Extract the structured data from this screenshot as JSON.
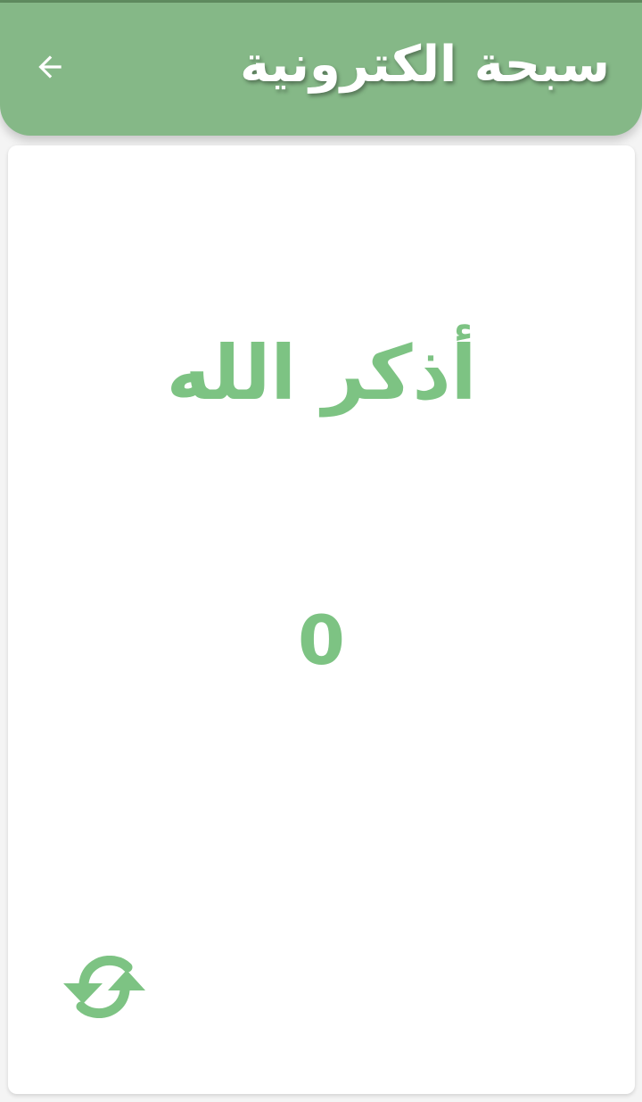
{
  "header": {
    "title": "سبحة الكترونية",
    "back_icon": "arrow-left-icon"
  },
  "main": {
    "dhikr_text": "أذكر الله",
    "counter_value": "0",
    "reset_icon": "refresh-icon"
  },
  "colors": {
    "header_background": "#85b887",
    "accent_green": "#7dc383",
    "card_background": "#ffffff",
    "page_background": "#f4f4f4"
  }
}
